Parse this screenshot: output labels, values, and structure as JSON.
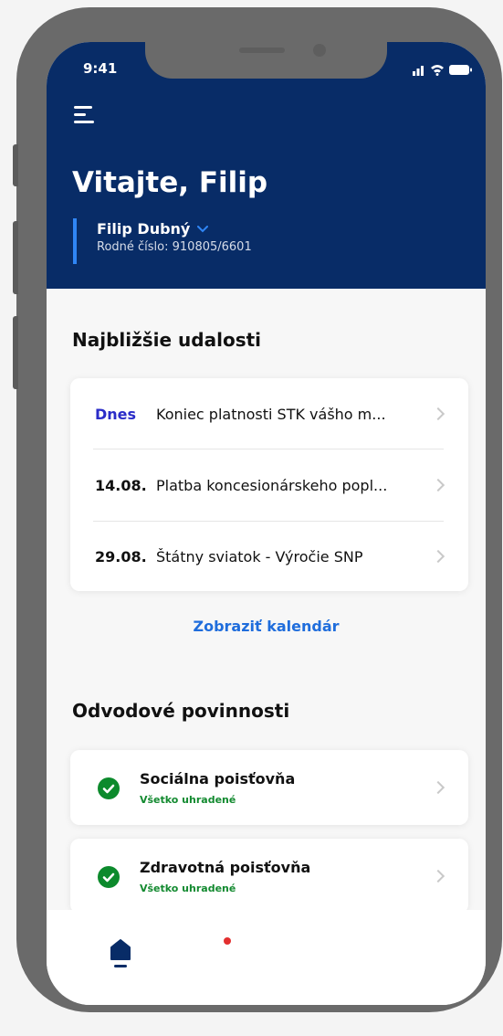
{
  "status_bar": {
    "time": "9:41"
  },
  "header": {
    "welcome": "Vitajte, Filip",
    "user_name": "Filip Dubný",
    "user_id": "Rodné číslo: 910805/6601"
  },
  "events": {
    "title": "Najbližšie udalosti",
    "items": [
      {
        "date": "Dnes",
        "text": "Koniec platnosti STK vášho m..."
      },
      {
        "date": "14.08.",
        "text": "Platba koncesionárskeho popl..."
      },
      {
        "date": "29.08.",
        "text": "Štátny sviatok - Výročie SNP"
      }
    ],
    "link_label": "Zobraziť kalendár"
  },
  "duties": {
    "title": "Odvodové povinnosti",
    "items": [
      {
        "name": "Sociálna poisťovňa",
        "status": "Všetko uhradené"
      },
      {
        "name": "Zdravotná poisťovňa",
        "status": "Všetko uhradené"
      }
    ]
  },
  "colors": {
    "header_bg": "#082c67",
    "accent_blue": "#2f86f6",
    "today_color": "#2a2cc8",
    "link_color": "#1f6ddc",
    "success_green": "#0c8a2c",
    "notification_red": "#e32f2f"
  },
  "icons": [
    "menu-icon",
    "chevron-down-icon",
    "chevron-right-icon",
    "check-circle-icon",
    "home-icon",
    "signal-icon",
    "wifi-icon",
    "battery-icon"
  ]
}
